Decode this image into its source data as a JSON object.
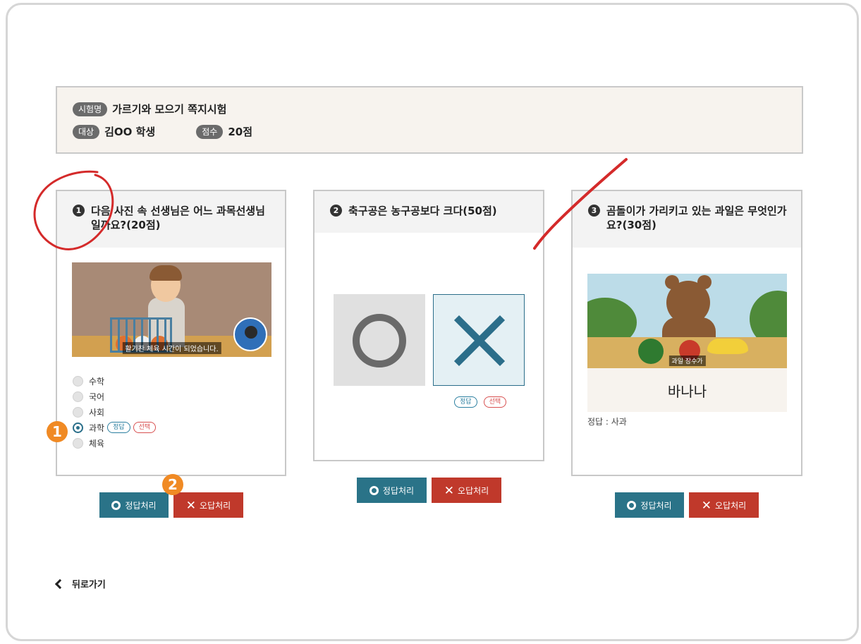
{
  "exam": {
    "name_label": "시험명",
    "name_value": "가르기와 모으기 쪽지시험",
    "target_label": "대상",
    "target_value": "김OO 학생",
    "score_label": "점수",
    "score_value": "20점"
  },
  "questions": [
    {
      "number": "1",
      "text": "다음 사진 속 선생님은 어느 과목선생님일까요?(20점)",
      "media_caption": "활기찬 체육 시간이 되었습니다.",
      "options": [
        "수학",
        "국어",
        "사회",
        "과학",
        "체육"
      ],
      "selected_option": "과학",
      "correct_tag": "정답",
      "selected_tag": "선택"
    },
    {
      "number": "2",
      "text": "축구공은 농구공보다 크다(50점)",
      "o_symbol": "O",
      "x_symbol": "X",
      "correct_tag": "정답",
      "selected_tag": "선택"
    },
    {
      "number": "3",
      "text": "곰돌이가 가리키고 있는 과일은 무엇인가요?(30점)",
      "media_caption": "과일 장수가",
      "student_answer": "바나나",
      "correct_answer_note": "정답 : 사과"
    }
  ],
  "buttons": {
    "mark_correct": "정답처리",
    "mark_wrong": "오답처리"
  },
  "nav": {
    "back_label": "뒤로가기"
  },
  "markers": [
    "1",
    "2"
  ],
  "colors": {
    "accent_teal": "#2a7388",
    "accent_red": "#c0392b",
    "marker_orange": "#f08a24",
    "annotation_red": "#d42a2a"
  }
}
